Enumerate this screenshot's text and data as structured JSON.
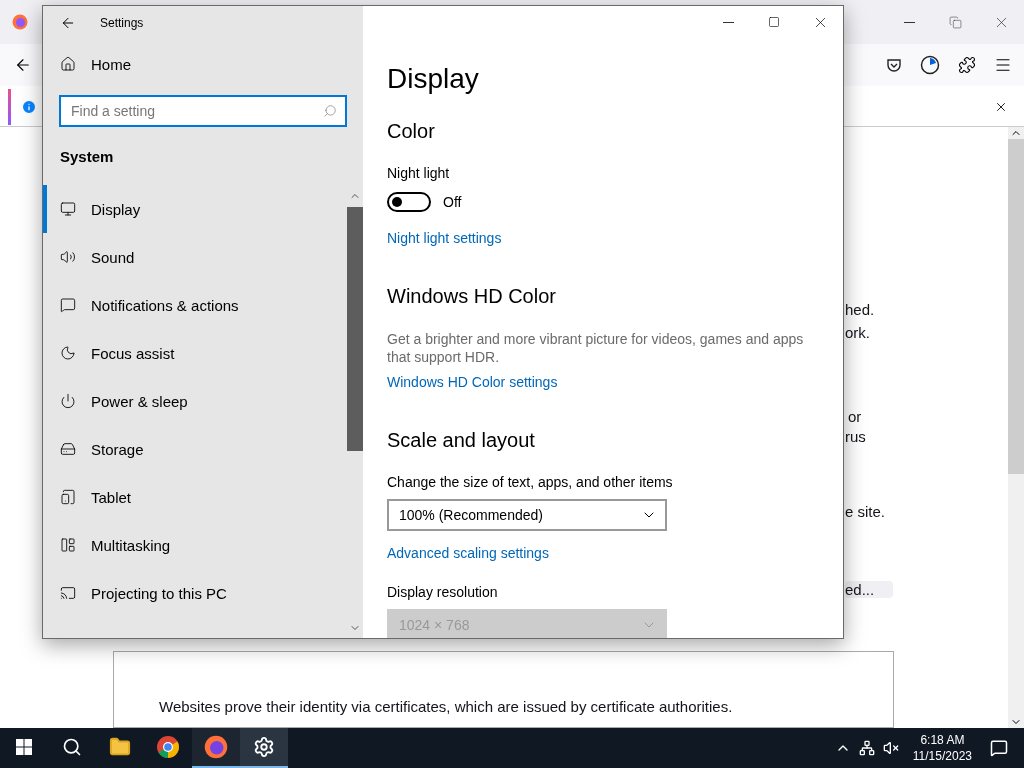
{
  "browser": {
    "page_text": [
      [
        "hed.",
        "ork."
      ],
      [
        "or",
        "rus"
      ],
      [
        "e site."
      ]
    ],
    "button": "ed...",
    "certificate_note": "Websites prove their identity via certificates, which are issued by certificate authorities."
  },
  "settings": {
    "title": "Settings",
    "home": "Home",
    "search": {
      "placeholder": "Find a setting"
    },
    "section": "System",
    "nav": [
      {
        "label": "Display",
        "selected": true
      },
      {
        "label": "Sound",
        "selected": false
      },
      {
        "label": "Notifications & actions",
        "selected": false
      },
      {
        "label": "Focus assist",
        "selected": false
      },
      {
        "label": "Power & sleep",
        "selected": false
      },
      {
        "label": "Storage",
        "selected": false
      },
      {
        "label": "Tablet",
        "selected": false
      },
      {
        "label": "Multitasking",
        "selected": false
      },
      {
        "label": "Projecting to this PC",
        "selected": false
      }
    ],
    "page_title": "Display",
    "sections": [
      {
        "heading": "Color",
        "items": [
          {
            "kind": "label",
            "text": "Night light"
          },
          {
            "kind": "toggle",
            "on": false,
            "state_text": "Off"
          },
          {
            "kind": "link",
            "text": "Night light settings"
          }
        ]
      },
      {
        "heading": "Windows HD Color",
        "items": [
          {
            "kind": "description",
            "text": "Get a brighter and more vibrant picture for videos, games and apps that support HDR."
          },
          {
            "kind": "link",
            "text": "Windows HD Color settings"
          }
        ]
      },
      {
        "heading": "Scale and layout",
        "items": [
          {
            "kind": "label",
            "text": "Change the size of text, apps, and other items"
          },
          {
            "kind": "dropdown",
            "value": "100% (Recommended)",
            "disabled": false
          },
          {
            "kind": "link",
            "text": "Advanced scaling settings"
          },
          {
            "kind": "label",
            "text": "Display resolution"
          },
          {
            "kind": "dropdown",
            "value": "1024 × 768",
            "disabled": true
          }
        ]
      }
    ]
  },
  "taskbar": {
    "apps": [
      {
        "running": false,
        "selected": false
      },
      {
        "running": false,
        "selected": false
      },
      {
        "running": true,
        "selected": false
      },
      {
        "running": true,
        "selected": true
      }
    ],
    "clock": {
      "time": "6:18 AM",
      "date": "11/15/2023"
    }
  }
}
